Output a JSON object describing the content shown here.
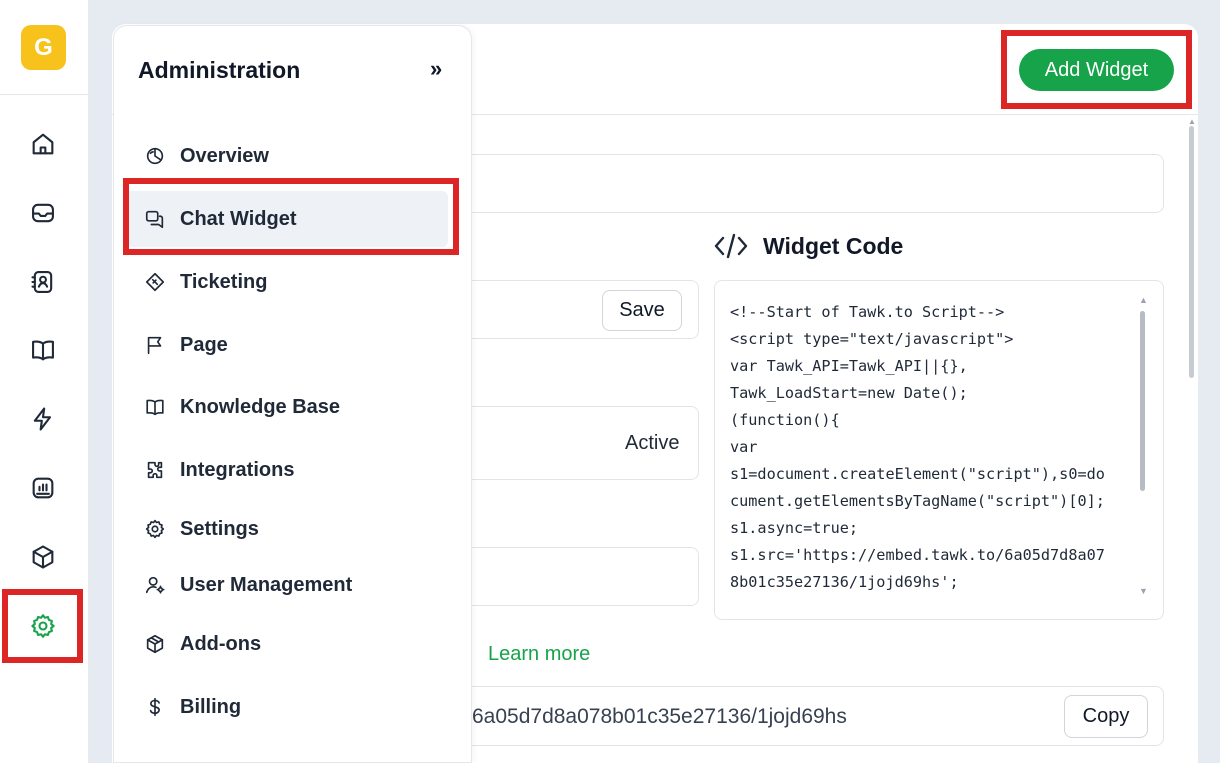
{
  "rail": {
    "logo_letter": "G",
    "icons": [
      "home-icon",
      "inbox-icon",
      "contacts-icon",
      "knowledge-base-icon",
      "automation-icon",
      "reports-icon",
      "addons-icon",
      "settings-icon"
    ],
    "active": "settings-icon"
  },
  "panel": {
    "title": "Administration",
    "collapse_label": "»",
    "items": [
      {
        "label": "Overview",
        "icon": "overview-icon"
      },
      {
        "label": "Chat Widget",
        "icon": "chat-widget-icon"
      },
      {
        "label": "Ticketing",
        "icon": "ticket-icon"
      },
      {
        "label": "Page",
        "icon": "flag-icon"
      },
      {
        "label": "Knowledge Base",
        "icon": "book-icon"
      },
      {
        "label": "Integrations",
        "icon": "puzzle-icon"
      },
      {
        "label": "Settings",
        "icon": "gear-icon"
      },
      {
        "label": "User Management",
        "icon": "user-gear-icon"
      },
      {
        "label": "Add-ons",
        "icon": "box-icon"
      },
      {
        "label": "Billing",
        "icon": "dollar-icon"
      }
    ],
    "active": "Chat Widget"
  },
  "header": {
    "add_widget_label": "Add Widget"
  },
  "form": {
    "save_label": "Save",
    "status_value": "Active",
    "learn_more_label": "Learn more",
    "direct_link_value": "6a05d7d8a078b01c35e27136/1jojd69hs",
    "copy_label": "Copy"
  },
  "widget_code": {
    "title": "Widget Code",
    "code": "<!--Start of Tawk.to Script-->\n<script type=\"text/javascript\">\nvar Tawk_API=Tawk_API||{},\nTawk_LoadStart=new Date();\n(function(){\nvar\ns1=document.createElement(\"script\"),s0=do\ncument.getElementsByTagName(\"script\")[0];\ns1.async=true;\ns1.src='https://embed.tawk.to/6a05d7d8a07\n8b01c35e27136/1jojd69hs';"
  },
  "colors": {
    "accent": "#16a34a",
    "highlight": "#dc2626",
    "logo": "#f7c21b"
  }
}
